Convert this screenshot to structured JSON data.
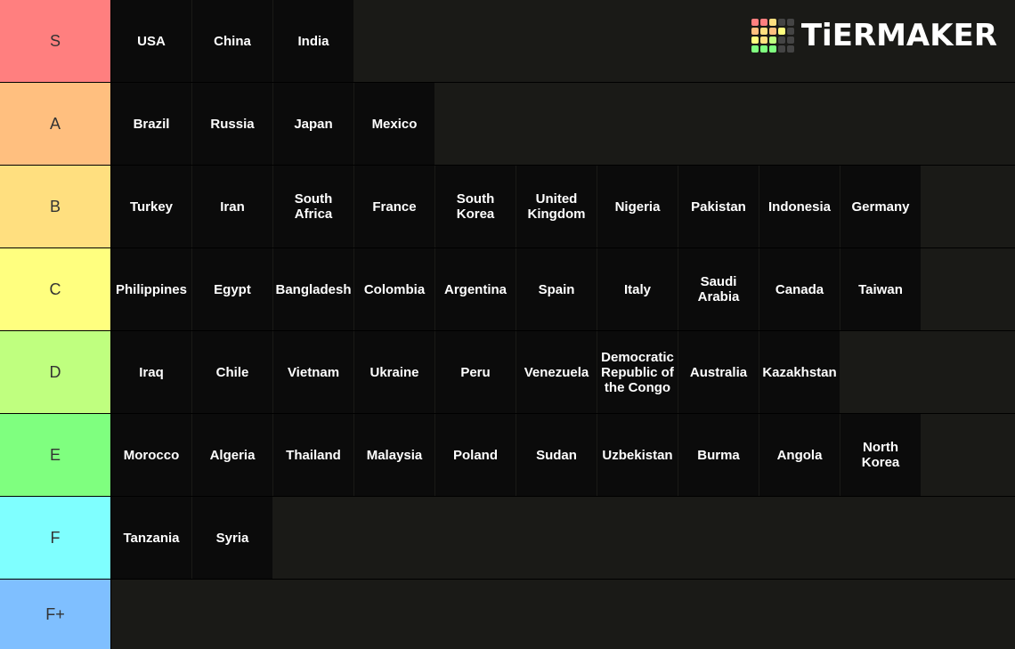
{
  "watermark": {
    "text": "TiERMAKER",
    "grid_colors": [
      "#ff7f7f",
      "#ff7f7f",
      "#ffdf7f",
      "#444444",
      "#444444",
      "#ffbf7f",
      "#ffdf7f",
      "#ffbf7f",
      "#ffff7f",
      "#444444",
      "#ffff7f",
      "#ffdf7f",
      "#bfff7f",
      "#444444",
      "#444444",
      "#7fff7f",
      "#7fff7f",
      "#7fff7f",
      "#444444",
      "#444444"
    ]
  },
  "tiers": [
    {
      "label": "S",
      "color": "#ff7f7f",
      "items": [
        "USA",
        "China",
        "India"
      ]
    },
    {
      "label": "A",
      "color": "#ffbf7f",
      "items": [
        "Brazil",
        "Russia",
        "Japan",
        "Mexico"
      ]
    },
    {
      "label": "B",
      "color": "#ffdf7f",
      "items": [
        "Turkey",
        "Iran",
        "South Africa",
        "France",
        "South Korea",
        "United Kingdom",
        "Nigeria",
        "Pakistan",
        "Indonesia",
        "Germany"
      ]
    },
    {
      "label": "C",
      "color": "#ffff7f",
      "items": [
        "Philippines",
        "Egypt",
        "Bangladesh",
        "Colombia",
        "Argentina",
        "Spain",
        "Italy",
        "Saudi Arabia",
        "Canada",
        "Taiwan"
      ]
    },
    {
      "label": "D",
      "color": "#bfff7f",
      "items": [
        "Iraq",
        "Chile",
        "Vietnam",
        "Ukraine",
        "Peru",
        "Venezuela",
        "Democratic Republic of the Congo",
        "Australia",
        "Kazakhstan"
      ]
    },
    {
      "label": "E",
      "color": "#7fff7f",
      "items": [
        "Morocco",
        "Algeria",
        "Thailand",
        "Malaysia",
        "Poland",
        "Sudan",
        "Uzbekistan",
        "Burma",
        "Angola",
        "North Korea"
      ]
    },
    {
      "label": "F",
      "color": "#7fffff",
      "items": [
        "Tanzania",
        "Syria"
      ]
    },
    {
      "label": "F+",
      "color": "#7fbfff",
      "items": []
    }
  ]
}
